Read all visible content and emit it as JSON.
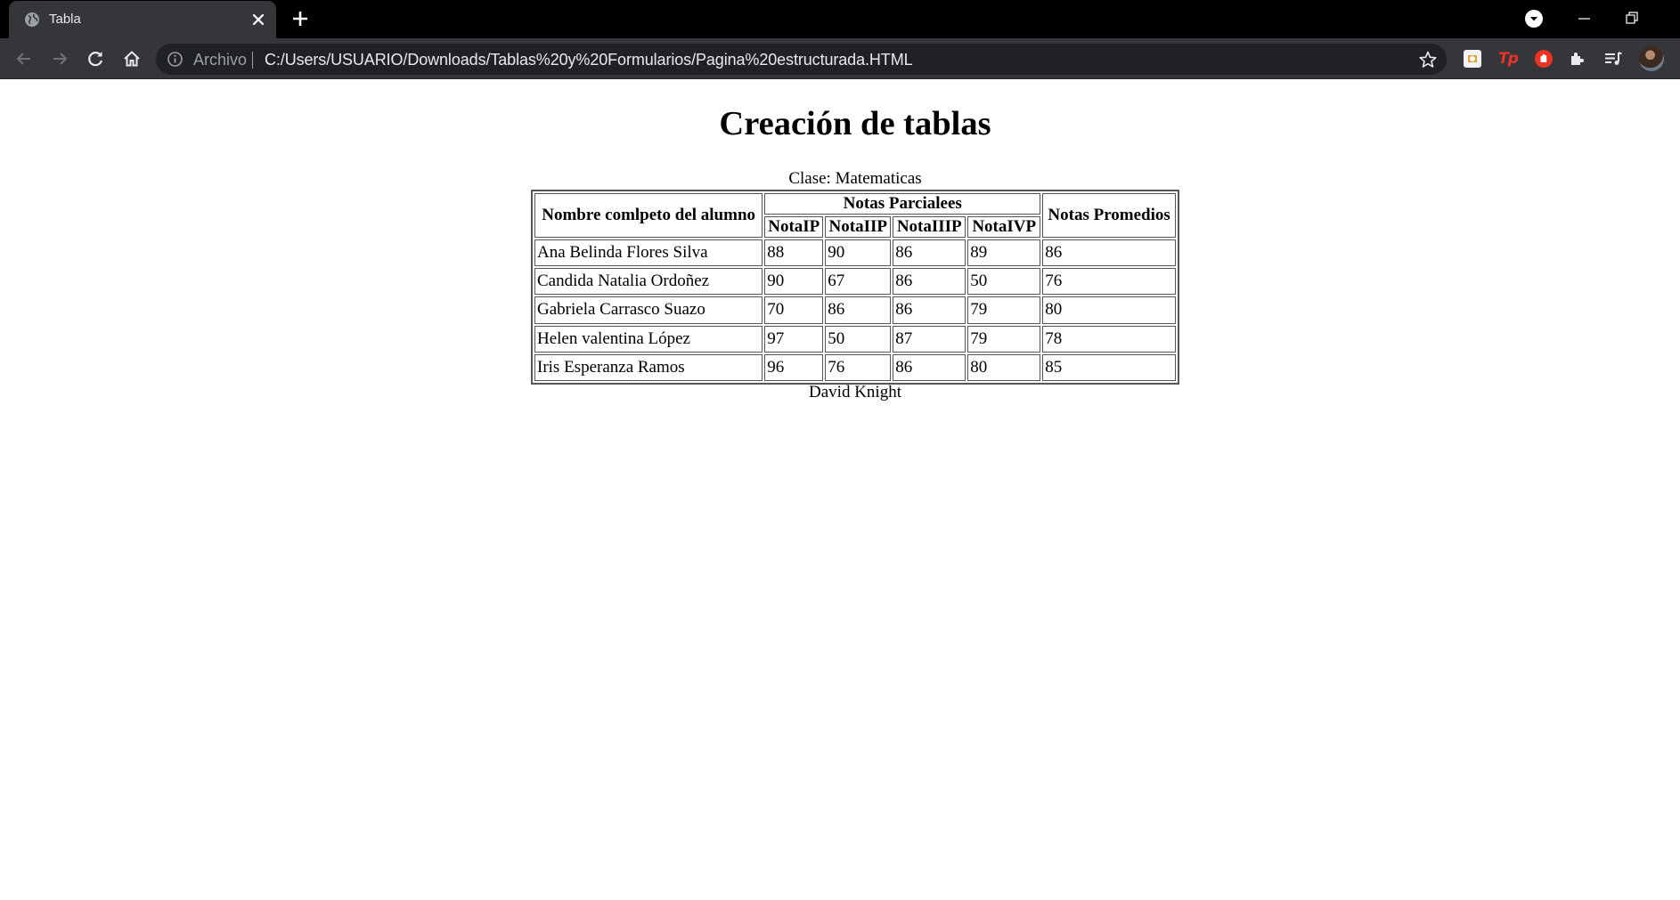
{
  "browser": {
    "tab": {
      "title": "Tabla"
    },
    "address_bar": {
      "scheme_label": "Archivo",
      "url": "C:/Users/USUARIO/Downloads/Tablas%20y%20Formularios/Pagina%20estructurada.HTML"
    },
    "extensions": {
      "tp_label": "Tp"
    }
  },
  "page": {
    "heading": "Creación de tablas",
    "caption": "Clase: Matematicas",
    "footer": "David Knight",
    "table": {
      "header_name": "Nombre comlpeto del alumno",
      "header_group": "Notas Parcialees",
      "sub_headers": [
        "NotaIP",
        "NotaIIP",
        "NotaIIIP",
        "NotaIVP"
      ],
      "header_average": "Notas Promedios",
      "rows": [
        {
          "name": "Ana Belinda Flores Silva",
          "notes": [
            "88",
            "90",
            "86",
            "89"
          ],
          "average": "86"
        },
        {
          "name": "Candida Natalia Ordoñez",
          "notes": [
            "90",
            "67",
            "86",
            "50"
          ],
          "average": "76"
        },
        {
          "name": "Gabriela Carrasco Suazo",
          "notes": [
            "70",
            "86",
            "86",
            "79"
          ],
          "average": "80"
        },
        {
          "name": "Helen valentina López",
          "notes": [
            "97",
            "50",
            "87",
            "79"
          ],
          "average": "78"
        },
        {
          "name": "Iris Esperanza Ramos",
          "notes": [
            "96",
            "76",
            "86",
            "80"
          ],
          "average": "85"
        }
      ]
    }
  },
  "colors": {
    "tabstrip": "#000000",
    "toolbar": "#35363a",
    "omnibox": "#202124",
    "text_light": "#e8eaed",
    "text_muted": "#9aa0a6",
    "extension_red": "#ea3323"
  },
  "icons": {
    "favicon": "globe-icon",
    "tab_close": "close-icon",
    "new_tab": "plus-icon",
    "back": "arrow-left-icon",
    "forward": "arrow-right-icon",
    "reload": "reload-icon",
    "home": "home-icon",
    "site_info": "info-icon",
    "bookmark": "star-icon"
  }
}
